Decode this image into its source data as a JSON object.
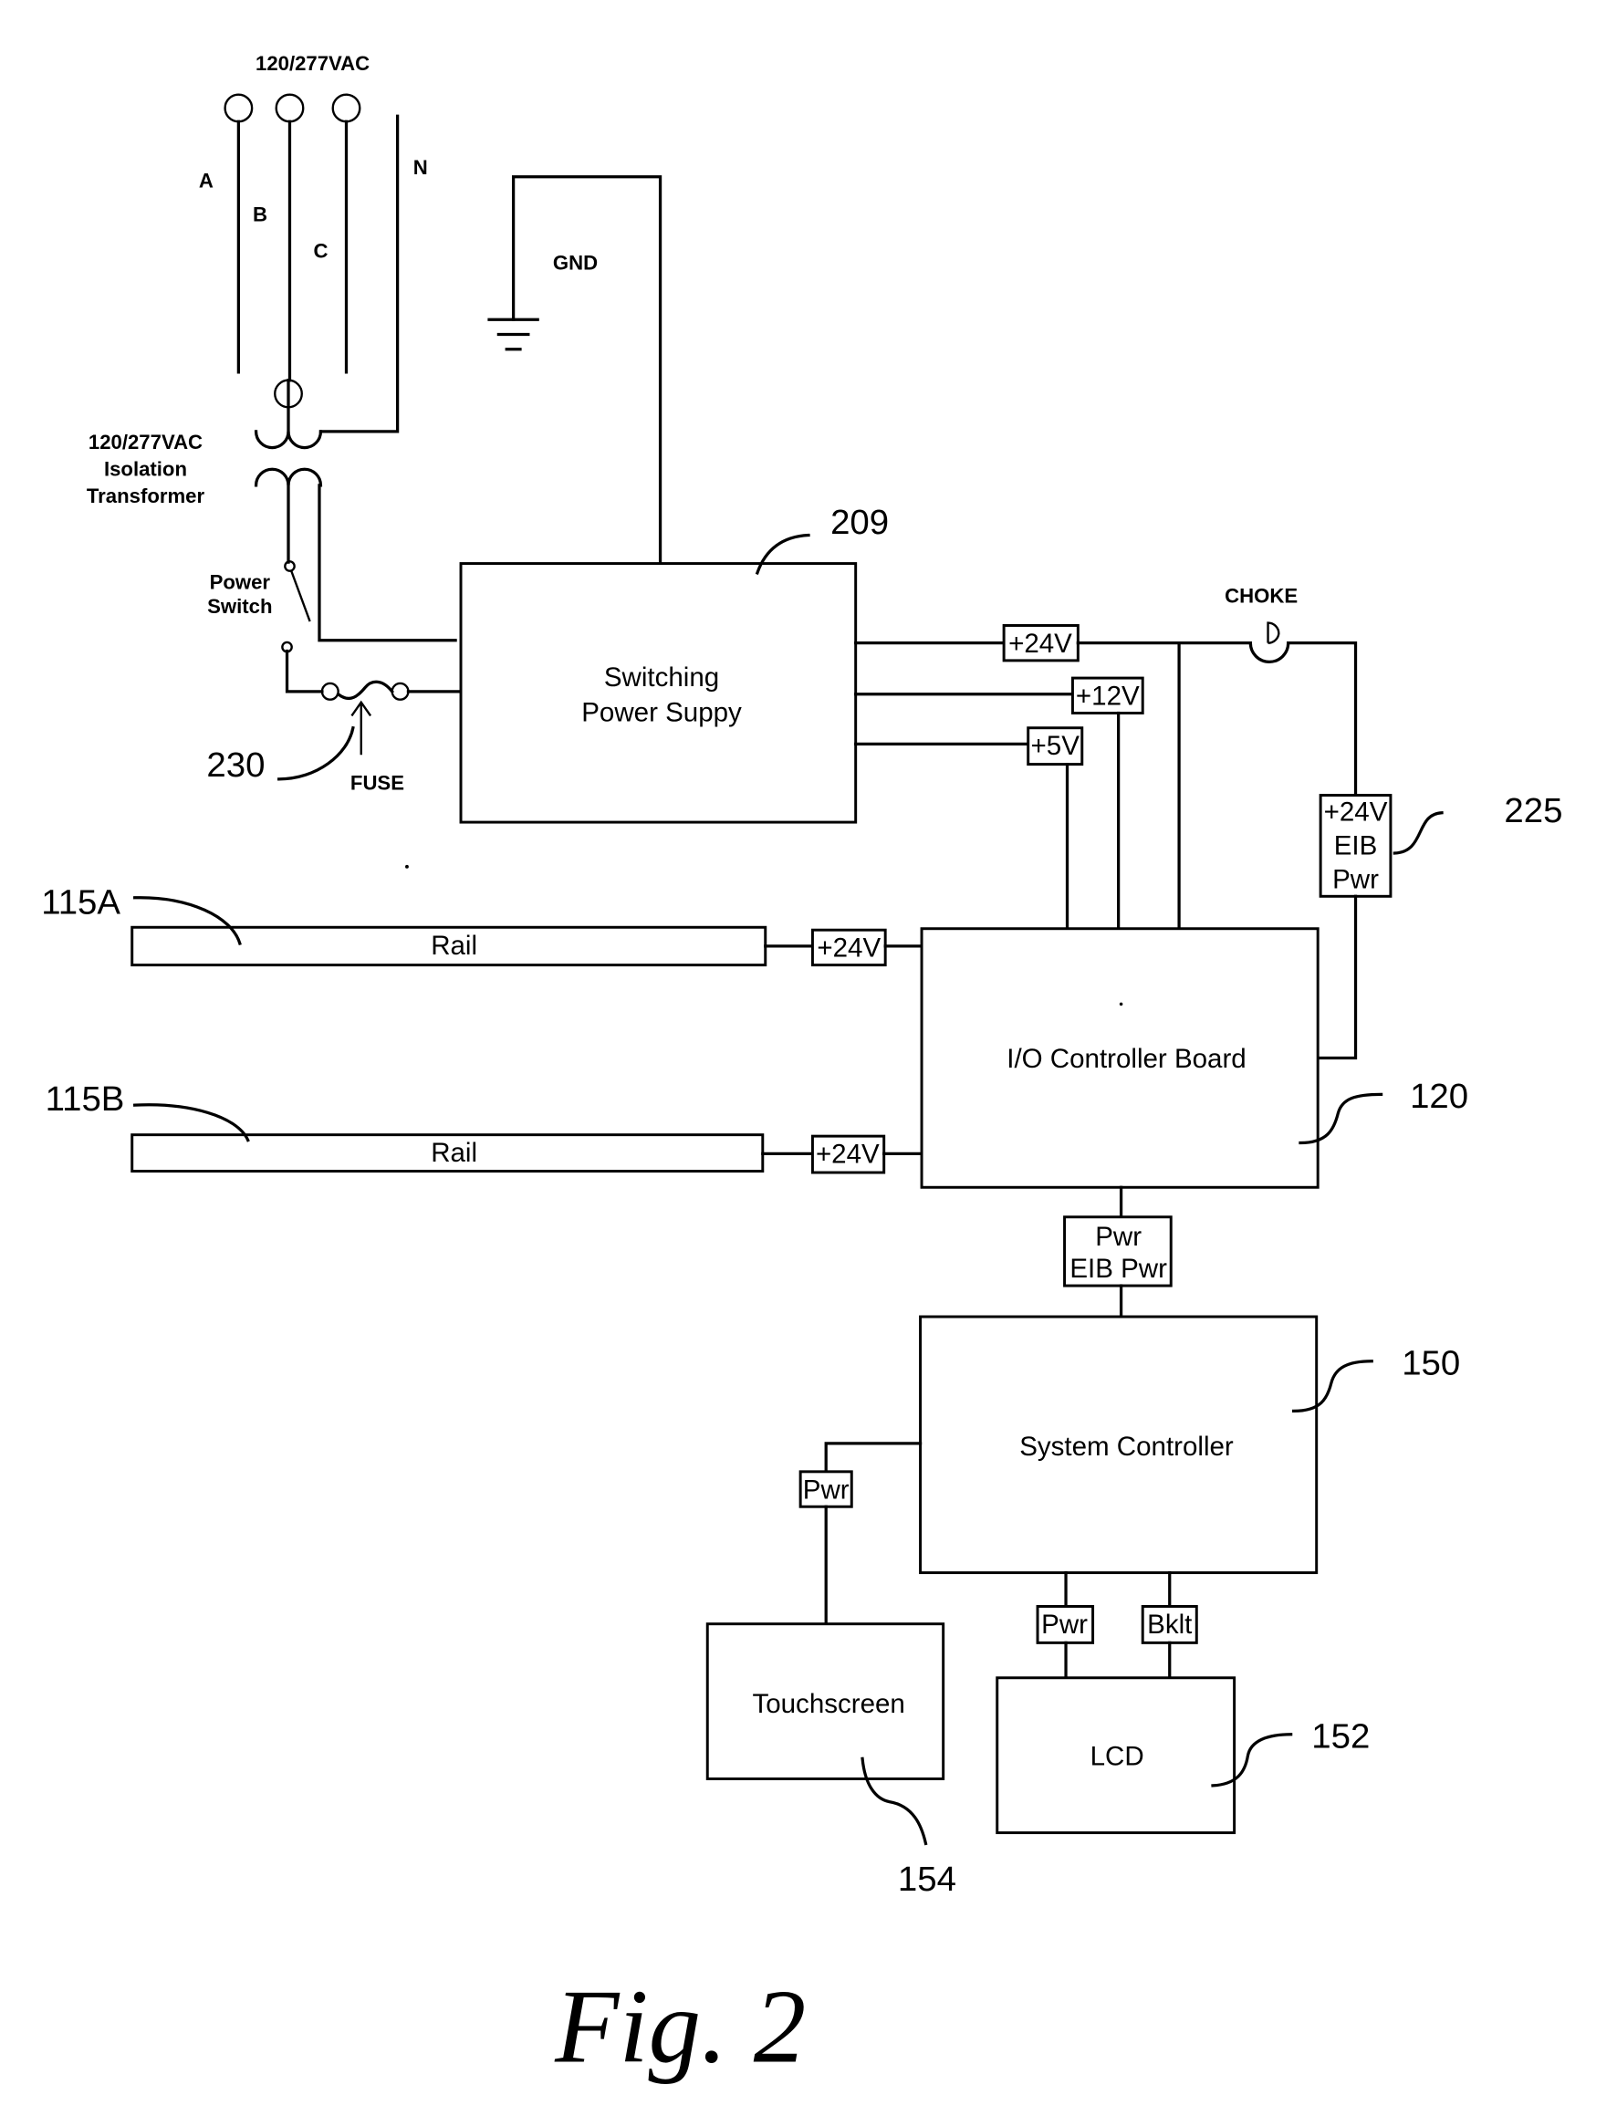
{
  "figure": {
    "caption": "Fig. 2",
    "type": "electrical block diagram"
  },
  "supply": {
    "top_voltage_label": "120/277VAC",
    "phases": [
      "A",
      "B",
      "C"
    ],
    "neutral": "N",
    "ground": "GND"
  },
  "transformer": {
    "label_lines": [
      "120/277VAC",
      "Isolation",
      "Transformer"
    ]
  },
  "power_switch": {
    "label_lines": [
      "Power",
      "Switch"
    ]
  },
  "fuse": {
    "label": "FUSE",
    "ref": "230"
  },
  "switching_power_supply": {
    "label_lines": [
      "Switching",
      "Power Suppy"
    ],
    "ref": "209",
    "outputs": [
      "+24V",
      "+12V",
      "+5V"
    ]
  },
  "choke": {
    "label": "CHOKE"
  },
  "eib_power": {
    "label_lines": [
      "+24V",
      "EIB",
      "Pwr"
    ],
    "ref": "225"
  },
  "rails": [
    {
      "ref": "115A",
      "label": "Rail",
      "feed": "+24V"
    },
    {
      "ref": "115B",
      "label": "Rail",
      "feed": "+24V"
    }
  ],
  "io_controller": {
    "label": "I/O Controller Board",
    "ref": "120"
  },
  "io_to_system_link": {
    "label_lines": [
      "Pwr",
      "EIB Pwr"
    ]
  },
  "system_controller": {
    "label": "System Controller",
    "ref": "150"
  },
  "touchscreen": {
    "label": "Touchscreen",
    "ref": "154",
    "feed": "Pwr"
  },
  "lcd": {
    "label": "LCD",
    "ref": "152",
    "feeds": [
      "Pwr",
      "Bklt"
    ]
  }
}
